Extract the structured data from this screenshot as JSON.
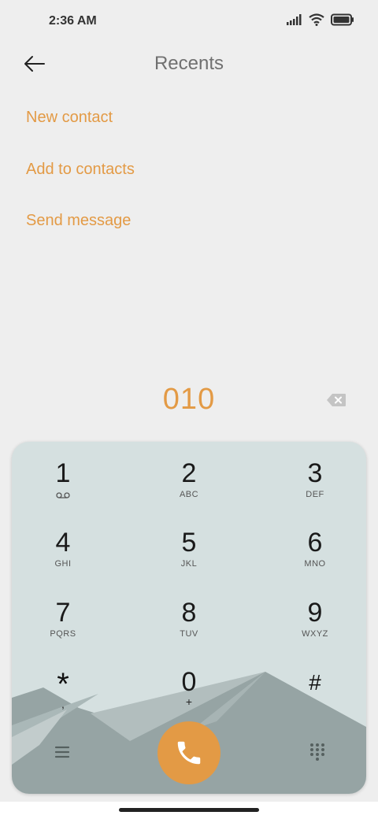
{
  "status_bar": {
    "time": "2:36 AM",
    "icons": [
      "signal-icon",
      "wifi-icon",
      "battery-icon"
    ]
  },
  "header": {
    "title": "Recents",
    "back_icon": "back-arrow-icon"
  },
  "menu": {
    "new_contact": "New contact",
    "add_to_contacts": "Add to contacts",
    "send_message": "Send message"
  },
  "dialer": {
    "number": "010",
    "backspace_icon": "backspace-icon"
  },
  "keypad": {
    "keys": [
      {
        "digit": "1",
        "letters": ""
      },
      {
        "digit": "2",
        "letters": "ABC"
      },
      {
        "digit": "3",
        "letters": "DEF"
      },
      {
        "digit": "4",
        "letters": "GHI"
      },
      {
        "digit": "5",
        "letters": "JKL"
      },
      {
        "digit": "6",
        "letters": "MNO"
      },
      {
        "digit": "7",
        "letters": "PQRS"
      },
      {
        "digit": "8",
        "letters": "TUV"
      },
      {
        "digit": "9",
        "letters": "WXYZ"
      },
      {
        "digit": "*",
        "letters": ","
      },
      {
        "digit": "0",
        "letters": "+"
      },
      {
        "digit": "#",
        "letters": ""
      }
    ],
    "bottom": {
      "menu_icon": "menu-icon",
      "call_icon": "phone-icon",
      "dialpad_icon": "dialpad-icon"
    }
  },
  "colors": {
    "accent": "#e39a45",
    "background": "#eeeeee",
    "keypad_bg": "#d5e0e0",
    "mountain": "#96a4a4"
  }
}
